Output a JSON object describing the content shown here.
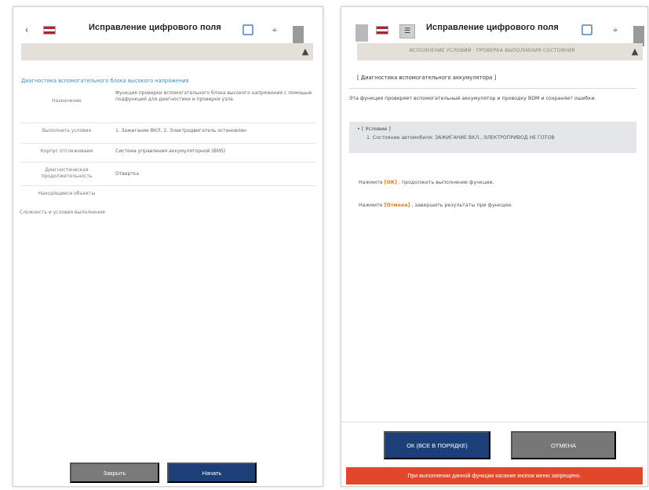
{
  "left_screen": {
    "title": "Исправление цифрового поля",
    "section_link": "Диагностика вспомогательного блока высокого напряжения",
    "rows": [
      {
        "key": "Назначение",
        "value": "Функция проверки вспомогательного блока высокого напряжения с помощью подфункций для диагностики и проверки узла."
      },
      {
        "key": "Выполнить условие",
        "value": "1. Зажигание ВКЛ. 2. Электродвигатель остановлен"
      },
      {
        "key": "Корпус отслеживаем",
        "value": "Система управления аккумуляторной (BMS)"
      },
      {
        "key": "Диагностическая продолжительность",
        "value": "Отвертка"
      },
      {
        "key": "Находящиеся объекты",
        "value": ""
      }
    ],
    "extra_label": "Сложность и условия выполнения",
    "buttons": {
      "close": "Закрыть",
      "start": "Начать"
    }
  },
  "right_screen": {
    "title": "Исправление цифрового поля",
    "infobar_text": "ИСПОЛНЕНИЕ УСЛОВИЙ · ПРОВЕРКА ВЫПОЛНЕНИЯ СОСТОЯНИЯ",
    "heading": "[ Диагностика вспомогательного аккумулятора ]",
    "description": "Эта функция проверяет вспомогательный аккумулятор и проводку BDM и сохраняет ошибки.",
    "condition_title": "• [ Условие ]",
    "condition_text": "1. Состояние автомобиля: ЗАЖИГАНИЕ ВКЛ., ЭЛЕКТРОПРИВОД НЕ ГОТОВ",
    "press_ok_prefix": "Нажмите",
    "press_ok_key": "[ОК]",
    "press_ok_suffix": ", продолжить выполнение функции.",
    "press_cancel_prefix": "Нажмите",
    "press_cancel_key": "[Отмена]",
    "press_cancel_suffix": ", завершить результаты при функции.",
    "buttons": {
      "ok": "ОК (ВСЕ В ПОРЯДКЕ)",
      "cancel": "ОТМЕНА"
    },
    "warning": "При выполнении данной функции касание кнопок меню запрещено."
  },
  "colors": {
    "primary_button": "#1c3f7a",
    "secondary_button": "#777777",
    "warning": "#e2472b",
    "link": "#3a8fc1",
    "accent": "#e07a1f"
  },
  "icons": [
    "back-icon",
    "flag-icon",
    "copy-icon",
    "expand-icon",
    "lock-icon",
    "list-icon"
  ]
}
